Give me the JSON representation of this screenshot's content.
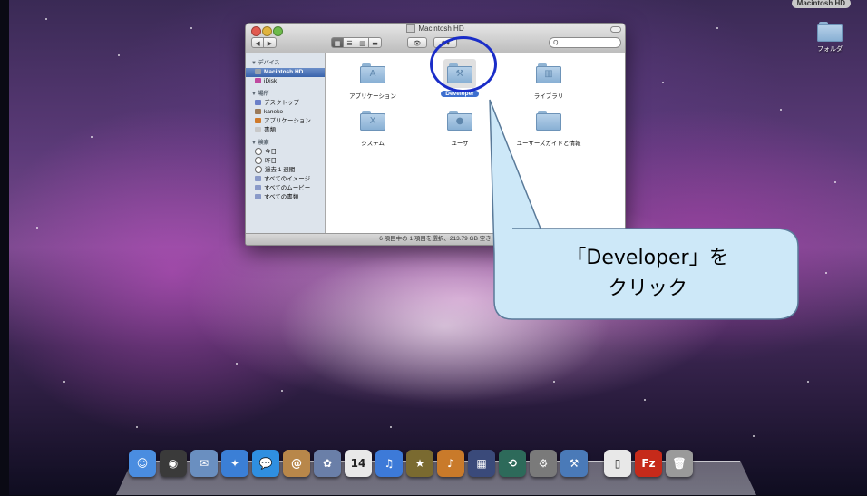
{
  "desktop": {
    "hd_label": "Macintosh HD",
    "folder_label": "フォルダ"
  },
  "window": {
    "title": "Macintosh HD",
    "search_placeholder": "Q",
    "toolbar": {
      "back": "◀",
      "forward": "▶",
      "view_icon": "▦",
      "view_list": "☰",
      "view_column": "▥",
      "view_coverflow": "▬",
      "quicklook": "👁",
      "action": "⚙▾"
    },
    "sidebar": {
      "sections": [
        {
          "header": "▼ デバイス",
          "items": [
            {
              "label": "Macintosh HD",
              "icon": "disk-icon",
              "selected": true
            },
            {
              "label": "iDisk",
              "icon": "idisk-icon",
              "selected": false
            }
          ]
        },
        {
          "header": "▼ 場所",
          "items": [
            {
              "label": "デスクトップ",
              "icon": "desktop-icon",
              "selected": false
            },
            {
              "label": "kaneko",
              "icon": "home-icon",
              "selected": false
            },
            {
              "label": "アプリケーション",
              "icon": "applications-icon",
              "selected": false
            },
            {
              "label": "書類",
              "icon": "documents-icon",
              "selected": false
            }
          ]
        },
        {
          "header": "▼ 検索",
          "items": [
            {
              "label": "今日",
              "icon": "clock-icon",
              "selected": false
            },
            {
              "label": "昨日",
              "icon": "clock-icon",
              "selected": false
            },
            {
              "label": "過去 1 週間",
              "icon": "clock-icon",
              "selected": false
            },
            {
              "label": "すべてのイメージ",
              "icon": "smart-folder-icon",
              "selected": false
            },
            {
              "label": "すべてのムービー",
              "icon": "smart-folder-icon",
              "selected": false
            },
            {
              "label": "すべての書類",
              "icon": "smart-folder-icon",
              "selected": false
            }
          ]
        }
      ]
    },
    "items": [
      {
        "label": "アプリケーション",
        "glyph": "A",
        "icon": "applications-folder-icon",
        "selected": false
      },
      {
        "label": "Developer",
        "glyph": "⚒",
        "icon": "developer-folder-icon",
        "selected": true
      },
      {
        "label": "ライブラリ",
        "glyph": "▥",
        "icon": "library-folder-icon",
        "selected": false
      },
      {
        "label": "システム",
        "glyph": "X",
        "icon": "system-folder-icon",
        "selected": false
      },
      {
        "label": "ユーザ",
        "glyph": "●",
        "icon": "users-folder-icon",
        "selected": false
      },
      {
        "label": "ユーザーズガイドと情報",
        "glyph": "",
        "icon": "folder-icon",
        "selected": false
      }
    ],
    "status": "6 項目中の 1 項目を選択、213.79 GB 空き"
  },
  "callout": {
    "line1": "「Developer」を",
    "line2": "クリック",
    "fill": "#cde8f8",
    "stroke": "#5a7a99"
  },
  "dock": {
    "items": [
      {
        "name": "finder-dock-icon",
        "glyph": "☺",
        "color": "#4a8de0"
      },
      {
        "name": "dashboard-dock-icon",
        "glyph": "◉",
        "color": "#3a3a3a"
      },
      {
        "name": "mail-dock-icon",
        "glyph": "✉",
        "color": "#6a8fc0"
      },
      {
        "name": "safari-dock-icon",
        "glyph": "✦",
        "color": "#3b7fd6"
      },
      {
        "name": "ichat-dock-icon",
        "glyph": "💬",
        "color": "#2f8fe0"
      },
      {
        "name": "address-book-dock-icon",
        "glyph": "@",
        "color": "#b8874a"
      },
      {
        "name": "iphoto-dock-icon",
        "glyph": "✿",
        "color": "#6a7fa8"
      },
      {
        "name": "ical-dock-icon",
        "glyph": "14",
        "color": "#e8e8e8"
      },
      {
        "name": "itunes-dock-icon",
        "glyph": "♫",
        "color": "#3d7ad8"
      },
      {
        "name": "imovie-dock-icon",
        "glyph": "★",
        "color": "#7a6a30"
      },
      {
        "name": "garageband-dock-icon",
        "glyph": "♪",
        "color": "#c97a2a"
      },
      {
        "name": "spaces-dock-icon",
        "glyph": "▦",
        "color": "#3a4a7a"
      },
      {
        "name": "time-machine-dock-icon",
        "glyph": "⟲",
        "color": "#2d6a5a"
      },
      {
        "name": "system-preferences-dock-icon",
        "glyph": "⚙",
        "color": "#7a7a7a"
      },
      {
        "name": "xcode-dock-icon",
        "glyph": "⚒",
        "color": "#4a7ab8"
      },
      {
        "name": "document-dock-icon",
        "glyph": "▯",
        "color": "#e8e8e8"
      },
      {
        "name": "filezilla-dock-icon",
        "glyph": "Fz",
        "color": "#c62a1a"
      },
      {
        "name": "trash-dock-icon",
        "glyph": "🗑",
        "color": "#9a9a9a"
      }
    ]
  }
}
